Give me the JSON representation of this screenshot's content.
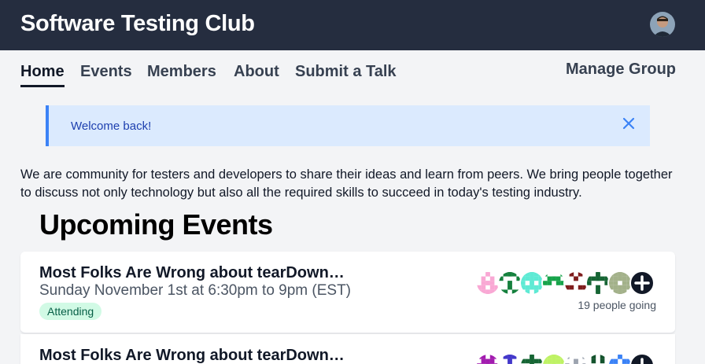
{
  "header": {
    "title": "Software Testing Club"
  },
  "nav": {
    "items": [
      {
        "label": "Home",
        "active": true
      },
      {
        "label": "Events",
        "active": false
      },
      {
        "label": "Members",
        "active": false
      },
      {
        "label": "About",
        "active": false
      },
      {
        "label": "Submit a Talk",
        "active": false
      }
    ],
    "manage_label": "Manage Group"
  },
  "alert": {
    "message": "Welcome back!"
  },
  "intro": "We are community for testers and developers to share their ideas and learn from peers. We bring people together to discuss not only technology but also all the required skills to succeed in today's testing industry.",
  "events_section": {
    "title": "Upcoming Events",
    "events": [
      {
        "title": "Most Folks Are Wrong about tearDown…",
        "date": "Sunday November 1st at 6:30pm to 9pm (EST)",
        "status": "Attending",
        "going": "19 people going",
        "avatar_colors": [
          "#f9a8d4",
          "#15803d",
          "#5eead4",
          "#16a34a",
          "#7f1d1d",
          "#166534",
          "#a3b18a"
        ]
      },
      {
        "title": "Most Folks Are Wrong about tearDown…",
        "avatar_colors": [
          "#a21caf",
          "#4338ca",
          "#166534",
          "#bef264",
          "#9ca3af",
          "#14532d",
          "#3b82f6"
        ]
      }
    ]
  },
  "colors": {
    "header_bg": "#252d3f",
    "alert_bg": "#dbeafe",
    "alert_accent": "#3b82f6",
    "badge_bg": "#d1fae5"
  }
}
